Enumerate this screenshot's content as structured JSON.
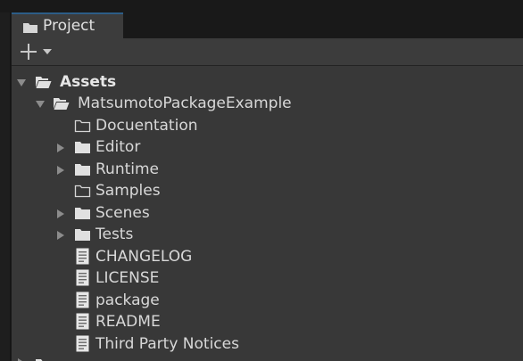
{
  "tab": {
    "label": "Project",
    "icon": "folder-icon"
  },
  "toolbar": {
    "create_icon": "plus-icon",
    "dropdown_icon": "caret-down-icon"
  },
  "tree": {
    "assets": "Assets",
    "package": "MatsumotoPackageExample",
    "children": {
      "documentation": "Docuentation",
      "editor": "Editor",
      "runtime": "Runtime",
      "samples": "Samples",
      "scenes": "Scenes",
      "tests": "Tests",
      "changelog": "CHANGELOG",
      "license": "LICENSE",
      "package": "package",
      "readme": "README",
      "third_party": "Third Party Notices"
    }
  },
  "colors": {
    "background": "#383838",
    "tab_accent": "#2c5d87",
    "text": "#d8d8d8"
  }
}
